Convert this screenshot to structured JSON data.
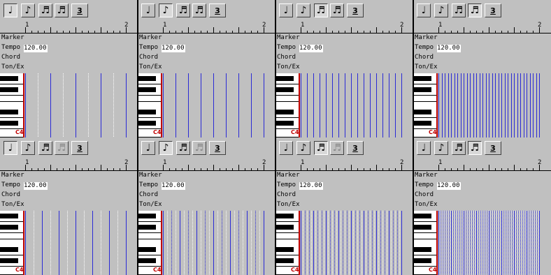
{
  "panels": [
    {
      "row": 0,
      "col": 0,
      "pressed": 0,
      "disabled": [],
      "density": "quarter"
    },
    {
      "row": 0,
      "col": 1,
      "pressed": 1,
      "disabled": [],
      "density": "eighth"
    },
    {
      "row": 0,
      "col": 2,
      "pressed": 2,
      "disabled": [],
      "density": "sixteenth"
    },
    {
      "row": 0,
      "col": 3,
      "pressed": 3,
      "disabled": [],
      "density": "thirtysecond"
    },
    {
      "row": 1,
      "col": 0,
      "pressed": 0,
      "disabled": [
        3
      ],
      "density": "quarter_trip"
    },
    {
      "row": 1,
      "col": 1,
      "pressed": 1,
      "disabled": [
        3
      ],
      "density": "eighth_trip"
    },
    {
      "row": 1,
      "col": 2,
      "pressed": 2,
      "disabled": [
        3
      ],
      "density": "sixteenth_trip"
    },
    {
      "row": 1,
      "col": 3,
      "pressed": 3,
      "disabled": [],
      "density": "thirtysecond_trip"
    }
  ],
  "toolbar_buttons": [
    {
      "name": "quarter-note",
      "glyph": "♩"
    },
    {
      "name": "eighth-note",
      "glyph": "♪"
    },
    {
      "name": "sixteenth-note",
      "glyph": "♬"
    },
    {
      "name": "thirtysecond-note",
      "glyph": "♬"
    },
    {
      "name": "triplet",
      "glyph": "3"
    }
  ],
  "ruler": {
    "start": "1",
    "end": "2"
  },
  "labels": {
    "marker": "Marker",
    "tempo": "Tempo",
    "chord": "Chord",
    "tonex": "Ton/Ex"
  },
  "tempo_value": "120.00",
  "key_label": "C4",
  "colors": {
    "grid_line": "#2a2ad6",
    "dotted": "#ffffff",
    "keys_edge": "#c00000"
  }
}
